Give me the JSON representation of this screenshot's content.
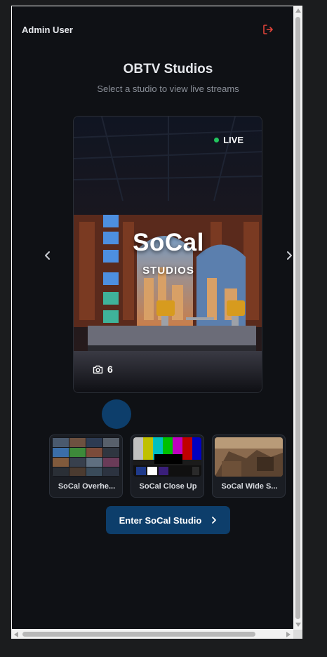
{
  "header": {
    "user_name": "Admin User",
    "logout_icon": "logout-icon",
    "accent": "#e0443a"
  },
  "page": {
    "title": "OBTV Studios",
    "subtitle": "Select a studio to view live streams"
  },
  "studio_card": {
    "name": "SoCal",
    "name_sub": "STUDIOS",
    "status": "LIVE",
    "status_color": "#22c55e",
    "camera_count": "6",
    "camera_icon": "camera-icon"
  },
  "carousel": {
    "prev_icon": "chevron-left-icon",
    "next_icon": "chevron-right-icon",
    "indicator_color": "#0d3e6b"
  },
  "streams": [
    {
      "label": "SoCal Overhe..."
    },
    {
      "label": "SoCal Close Up"
    },
    {
      "label": "SoCal Wide S..."
    }
  ],
  "enter_button": {
    "label": "Enter SoCal Studio",
    "icon": "chevron-right-icon",
    "color": "#0d3e6b"
  }
}
